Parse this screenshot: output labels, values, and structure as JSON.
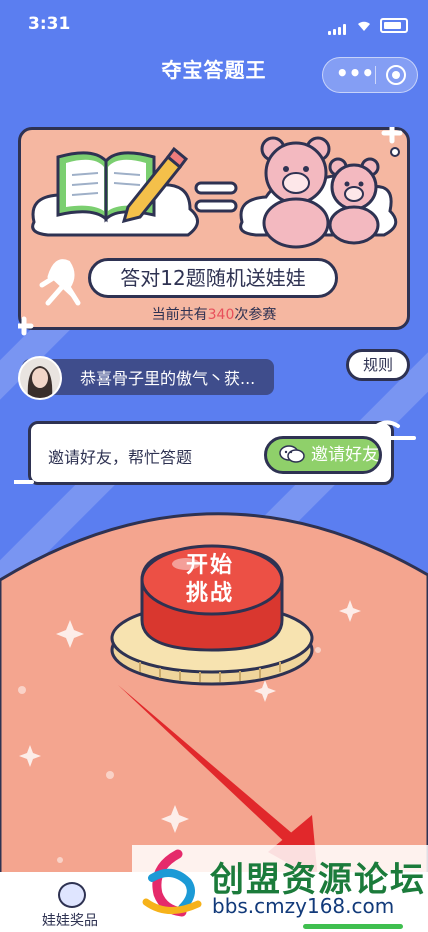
{
  "status_bar": {
    "time": "3:31"
  },
  "nav": {
    "title": "夺宝答题王",
    "capsule_dots": "•••"
  },
  "banner": {
    "slogan": "答对12题随机送娃娃",
    "count_prefix": "当前共有",
    "count_num": "340",
    "count_suffix": "次参赛"
  },
  "notice": {
    "text": "恭喜骨子里的傲气丶获..."
  },
  "rules_label": "规则",
  "invite": {
    "text": "邀请好友，帮忙答题",
    "button_label": "邀请好友"
  },
  "start": {
    "line1": "开始",
    "line2": "挑战"
  },
  "tabbar": {
    "prize_label": "娃娃奖品"
  },
  "watermark": {
    "cn": "创盟资源论坛",
    "url": "bbs.cmzy168.com"
  },
  "colors": {
    "bg_blue": "#5b7ef0",
    "peach": "#f5b7a1",
    "button_red": "#e0443c",
    "invite_green": "#8fd06a",
    "outline": "#2e3252"
  }
}
